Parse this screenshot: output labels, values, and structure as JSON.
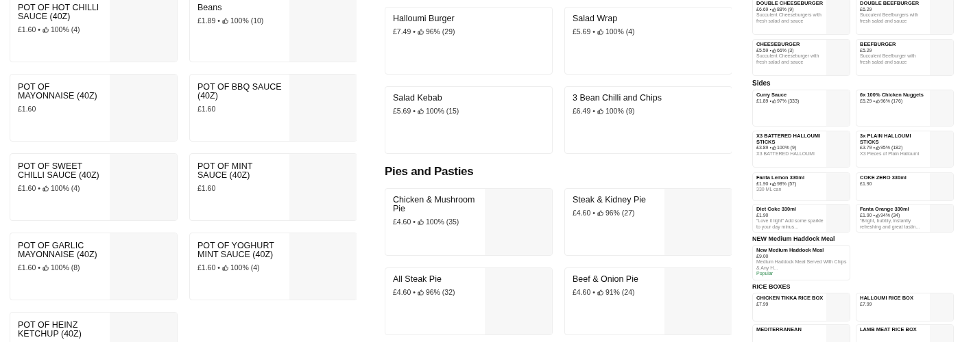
{
  "panels": [
    {
      "sections": [
        {
          "items": [
            {
              "name": "POT OF HOT CHILLI SAUCE (40Z)",
              "price": "£1.60 •",
              "rating": "100% (4)",
              "image_slot": true
            },
            {
              "name": "Beans",
              "price": "£1.89 •",
              "rating": "100% (10)",
              "image_slot": true
            },
            {
              "name": "POT OF MAYONNAISE (40Z)",
              "price": "£1.60",
              "image_slot": true
            },
            {
              "name": "POT OF BBQ SAUCE (40Z)",
              "price": "£1.60",
              "image_slot": true
            },
            {
              "name": "POT OF SWEET CHILLI SAUCE (40Z)",
              "price": "£1.60 •",
              "rating": "100% (4)",
              "image_slot": true
            },
            {
              "name": "POT OF MINT SAUCE (40Z)",
              "price": "£1.60",
              "image_slot": true
            },
            {
              "name": "POT OF GARLIC MAYONNAISE (40Z)",
              "price": "£1.60 •",
              "rating": "100% (8)",
              "image_slot": true
            },
            {
              "name": "POT OF YOGHURT MINT SAUCE (40Z)",
              "price": "£1.60 •",
              "rating": "100% (4)",
              "image_slot": true
            },
            {
              "name": "POT OF HEINZ KETCHUP (40Z)",
              "image_slot": true
            }
          ]
        }
      ]
    },
    {
      "sections": [
        {
          "items": [
            {
              "name": "Halloumi Burger",
              "price": "£7.49 •",
              "rating": "96% (29)",
              "image_slot": false
            },
            {
              "name": "Salad Wrap",
              "price": "£5.69 •",
              "rating": "100% (4)",
              "image_slot": false
            },
            {
              "name": "Salad Kebab",
              "price": "£5.69 •",
              "rating": "100% (15)",
              "image_slot": false
            },
            {
              "name": "3 Bean Chilli and Chips",
              "price": "£6.49 •",
              "rating": "100% (9)",
              "image_slot": false
            }
          ]
        },
        {
          "heading": "Pies and Pasties",
          "items": [
            {
              "name": "Chicken & Mushroom Pie",
              "price": "£4.60 •",
              "rating": "100% (35)",
              "image_slot": true
            },
            {
              "name": "Steak & Kidney Pie",
              "price": "£4.60 •",
              "rating": "96% (27)",
              "image_slot": true
            },
            {
              "name": "All Steak Pie",
              "price": "£4.60 •",
              "rating": "96% (32)",
              "image_slot": true
            },
            {
              "name": "Beef & Onion Pie",
              "price": "£4.60 •",
              "rating": "91% (24)",
              "image_slot": true
            }
          ]
        }
      ]
    },
    {
      "sections": [
        {
          "items": [
            {
              "name": "DOUBLE CHEESEBURGER",
              "price": "£6.69 •",
              "rating": "88% (9)",
              "description": "Succulent Cheeseburgers with fresh salad and sauce",
              "image_slot": true
            },
            {
              "name": "DOUBLE BEEFBURGER",
              "price": "£6.29",
              "description": "Succulent Beefburgers with fresh salad and sauce",
              "image_slot": true
            },
            {
              "name": "CHEESEBURGER",
              "price": "£5.59 •",
              "rating": "66% (3)",
              "description": "Succulent Cheeseburger with fresh salad and sauce",
              "image_slot": true
            },
            {
              "name": "BEEFBURGER",
              "price": "£5.29",
              "description": "Succulent Beefburger with fresh salad and sauce",
              "image_slot": true
            }
          ]
        },
        {
          "heading": "Sides",
          "items": [
            {
              "name": "Curry Sauce",
              "price": "£1.89 •",
              "rating": "97% (333)",
              "image_slot": true
            },
            {
              "name": "6x 100% Chicken Nuggets",
              "price": "£5.29 •",
              "rating": "96% (176)",
              "image_slot": true
            },
            {
              "name": "X3 BATTERED HALLOUMI STICKS",
              "price": "£3.89 •",
              "rating": "100% (9)",
              "description": "X3 BATTERED HALLOUMI",
              "image_slot": true
            },
            {
              "name": "3x PLAIN HALLOUMI STICKS",
              "price": "£3.79 •",
              "rating": "95% (182)",
              "description": "X3 Pieces of Plain Halloumi",
              "image_slot": true
            }
          ]
        }
      ]
    },
    {
      "sections": [
        {
          "items": [
            {
              "name": "Fanta Lemon 330ml",
              "price": "£1.90 •",
              "rating": "98% (57)",
              "description": "330 ML can",
              "image_slot": true
            },
            {
              "name": "COKE ZERO 330ml",
              "price": "£1.90",
              "image_slot": true
            },
            {
              "name": "Diet Coke 330ml",
              "price": "£1.90",
              "description": "“Love it light” Add some sparkle to your day minus...",
              "image_slot": true
            },
            {
              "name": "Fanta Orange 330ml",
              "price": "£1.90 •",
              "rating": "94% (34)",
              "description": "“Bright, bubbly, instantly refreshing and great tastin...",
              "image_slot": true
            }
          ]
        },
        {
          "heading": "NEW Medium Haddock Meal",
          "items": [
            {
              "name": "New Medium Haddock Meal",
              "price": "£9.00",
              "description": "Medium Haddock Meal Served With Chips & Any H...",
              "badge": "Popular",
              "image_slot": false
            }
          ]
        },
        {
          "heading": "RICE BOXES",
          "items": [
            {
              "name": "CHICKEN TIKKA RICE BOX",
              "price": "£7.99",
              "image_slot": true
            },
            {
              "name": "HALLOUMI RICE BOX",
              "price": "£7.99",
              "image_slot": true
            },
            {
              "name": "MEDITERRANEAN",
              "image_slot": true
            },
            {
              "name": "LAMB MEAT RICE BOX",
              "image_slot": true
            }
          ]
        }
      ]
    }
  ]
}
